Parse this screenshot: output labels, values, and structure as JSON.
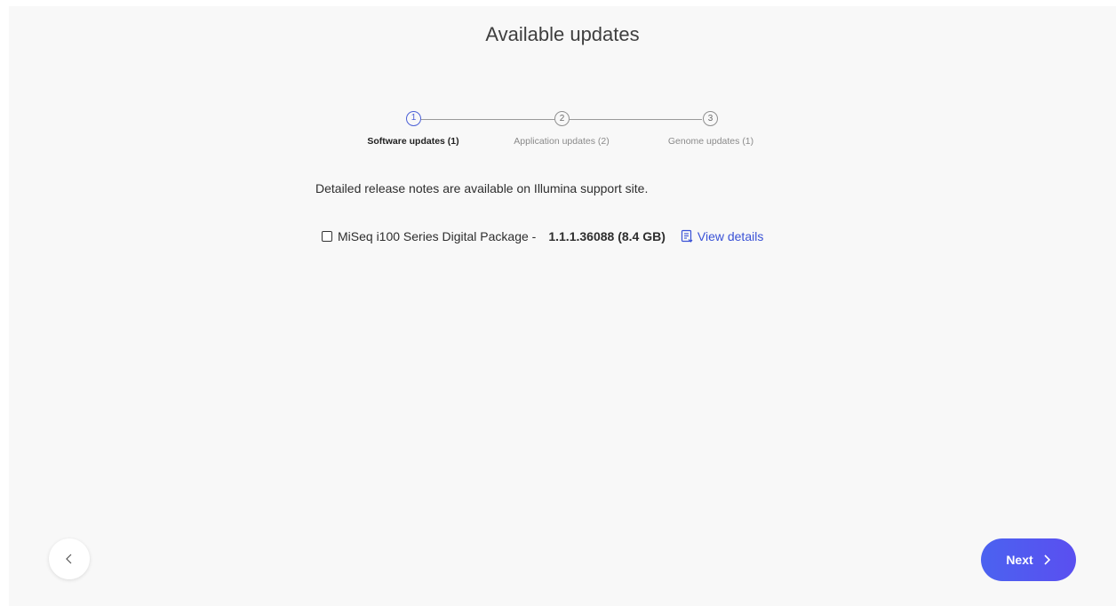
{
  "header": {
    "title": "Available updates"
  },
  "stepper": {
    "steps": [
      {
        "number": "1",
        "label": "Software updates (1)",
        "active": true
      },
      {
        "number": "2",
        "label": "Application updates (2)",
        "active": false
      },
      {
        "number": "3",
        "label": "Genome updates (1)",
        "active": false
      }
    ]
  },
  "content": {
    "release_notes": "Detailed release notes are available on Illumina support site.",
    "package": {
      "name": "MiSeq i100 Series Digital Package -",
      "version": "1.1.1.36088 (8.4 GB)",
      "checked": false,
      "view_details_label": "View details"
    }
  },
  "footer": {
    "back_icon": "chevron-left-icon",
    "next_label": "Next",
    "next_icon": "chevron-right-icon"
  },
  "colors": {
    "accent": "#4b5fd6",
    "link": "#3a52d6",
    "next_gradient_start": "#4b62f0",
    "next_gradient_end": "#5a4ff0",
    "background": "#f8f8f8"
  }
}
